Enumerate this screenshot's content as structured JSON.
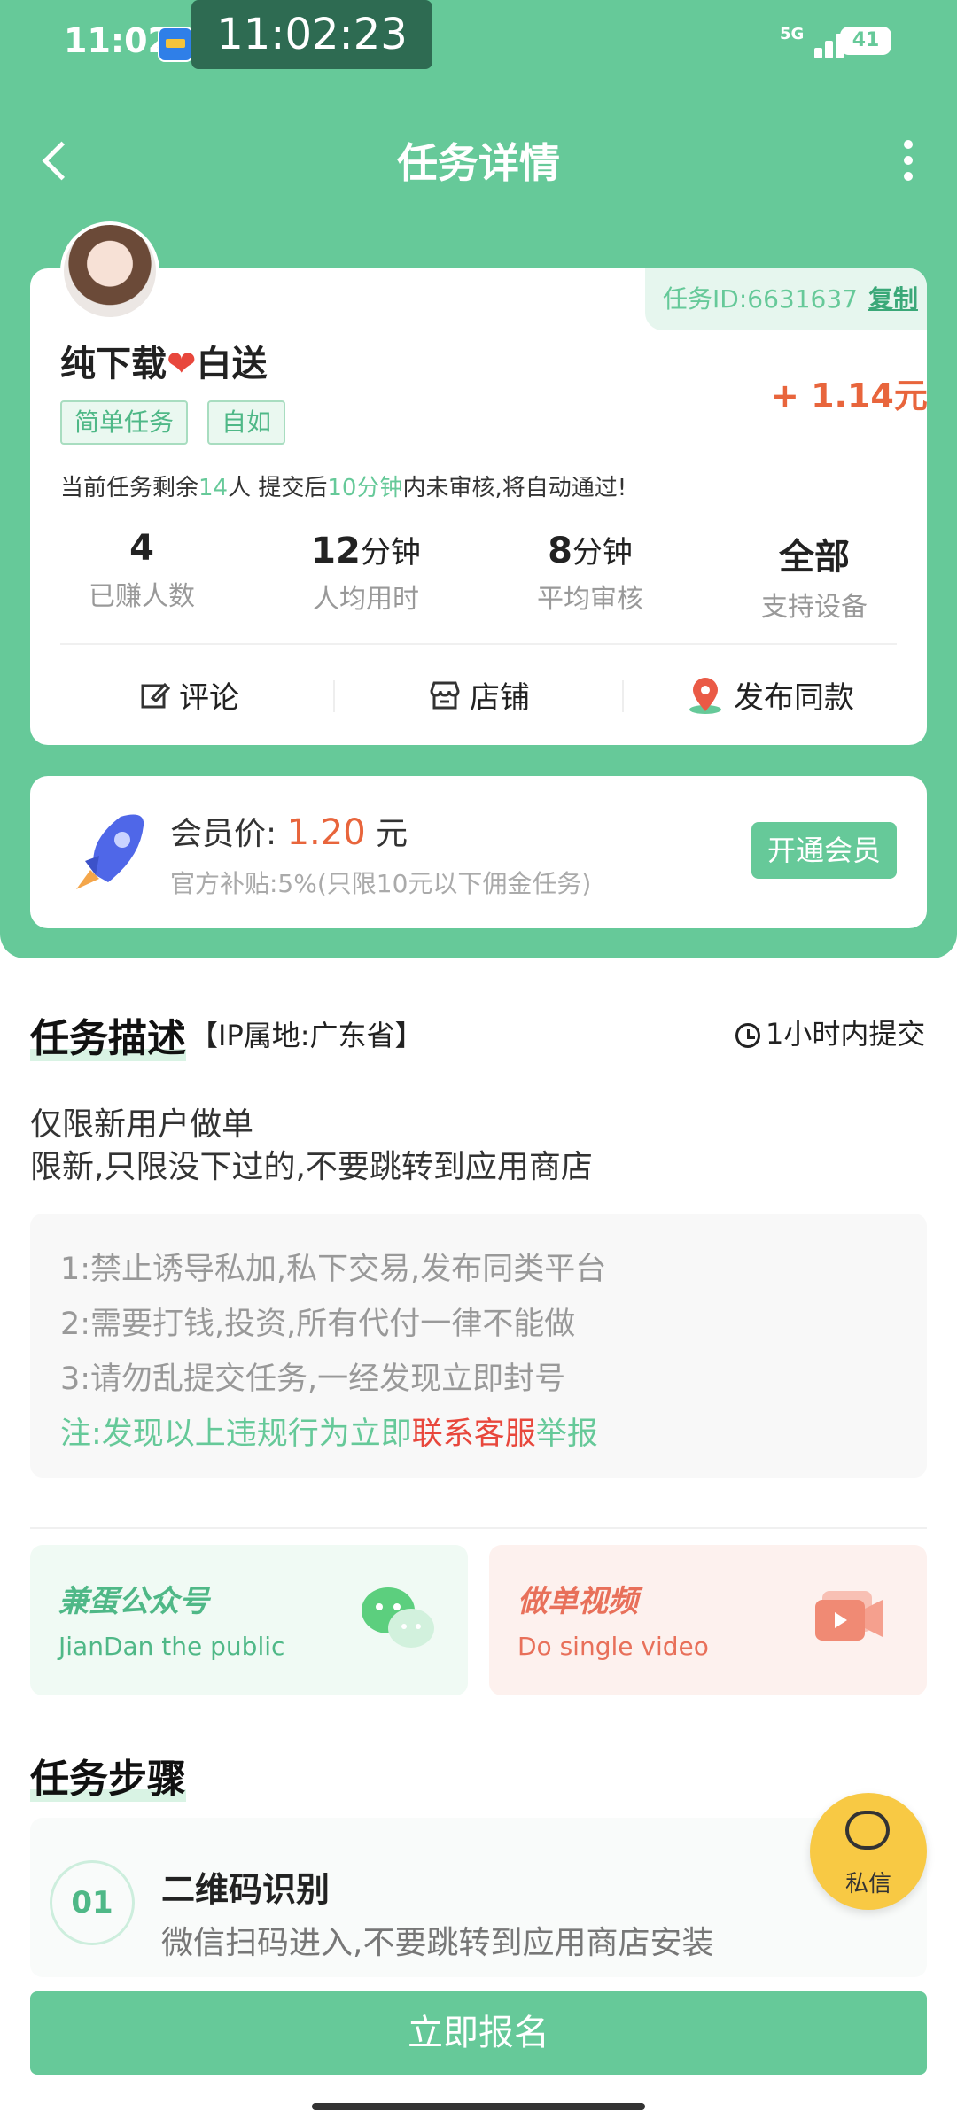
{
  "status_bar": {
    "time": "11:02",
    "overlay_clock": "11:02:23",
    "network": "5G",
    "battery": "41"
  },
  "nav": {
    "title": "任务详情"
  },
  "task": {
    "id_label": "任务ID:6631637",
    "copy_label": "复制",
    "title_part1": "纯下载",
    "title_heart": "❤",
    "title_part2": "白送",
    "price": "+ 1.14元",
    "tags": [
      "简单任务",
      "自如"
    ],
    "notice_prefix": "当前任务剩余",
    "notice_remaining": "14",
    "notice_mid": "人  提交后",
    "notice_minutes": "10分钟",
    "notice_suffix": "内未审核,将自动通过!",
    "stats": [
      {
        "value": "4",
        "unit": "",
        "label": "已赚人数"
      },
      {
        "value": "12",
        "unit": "分钟",
        "label": "人均用时"
      },
      {
        "value": "8",
        "unit": "分钟",
        "label": "平均审核"
      },
      {
        "value": "全部",
        "unit": "",
        "label": "支持设备"
      }
    ],
    "actions": [
      "评论",
      "店铺",
      "发布同款"
    ]
  },
  "vip": {
    "label": "会员价:",
    "price": "1.20",
    "unit": "元",
    "subsidy": "官方补贴:5%(只限10元以下佣金任务)",
    "button": "开通会员"
  },
  "description": {
    "title": "任务描述",
    "ip": "【IP属地:广东省】",
    "deadline": "1小时内提交",
    "line1": "仅限新用户做单",
    "line2": "限新,只限没下过的,不要跳转到应用商店",
    "rules": [
      "1:禁止诱导私加,私下交易,发布同类平台",
      "2:需要打钱,投资,所有代付一律不能做",
      "3:请勿乱提交任务,一经发现立即封号"
    ],
    "note_prefix": "注:发现以上违规行为立即",
    "note_red": "联系客服",
    "note_suffix": "举报"
  },
  "promos": [
    {
      "title": "兼蛋公众号",
      "subtitle": "JianDan the public",
      "color": "#4fb887",
      "bg": "#f0faf4"
    },
    {
      "title": "做单视频",
      "subtitle": "Do single video",
      "color": "#e8705a",
      "bg": "#fdf1ee"
    }
  ],
  "steps": {
    "title": "任务步骤",
    "items": [
      {
        "num": "01",
        "title": "二维码识别",
        "desc": "微信扫码进入,不要跳转到应用商店安装"
      }
    ]
  },
  "floating": {
    "label": "私信"
  },
  "cta": {
    "label": "立即报名"
  },
  "colors": {
    "primary": "#66c999",
    "price": "#e8653c",
    "warning": "#e8473c"
  }
}
